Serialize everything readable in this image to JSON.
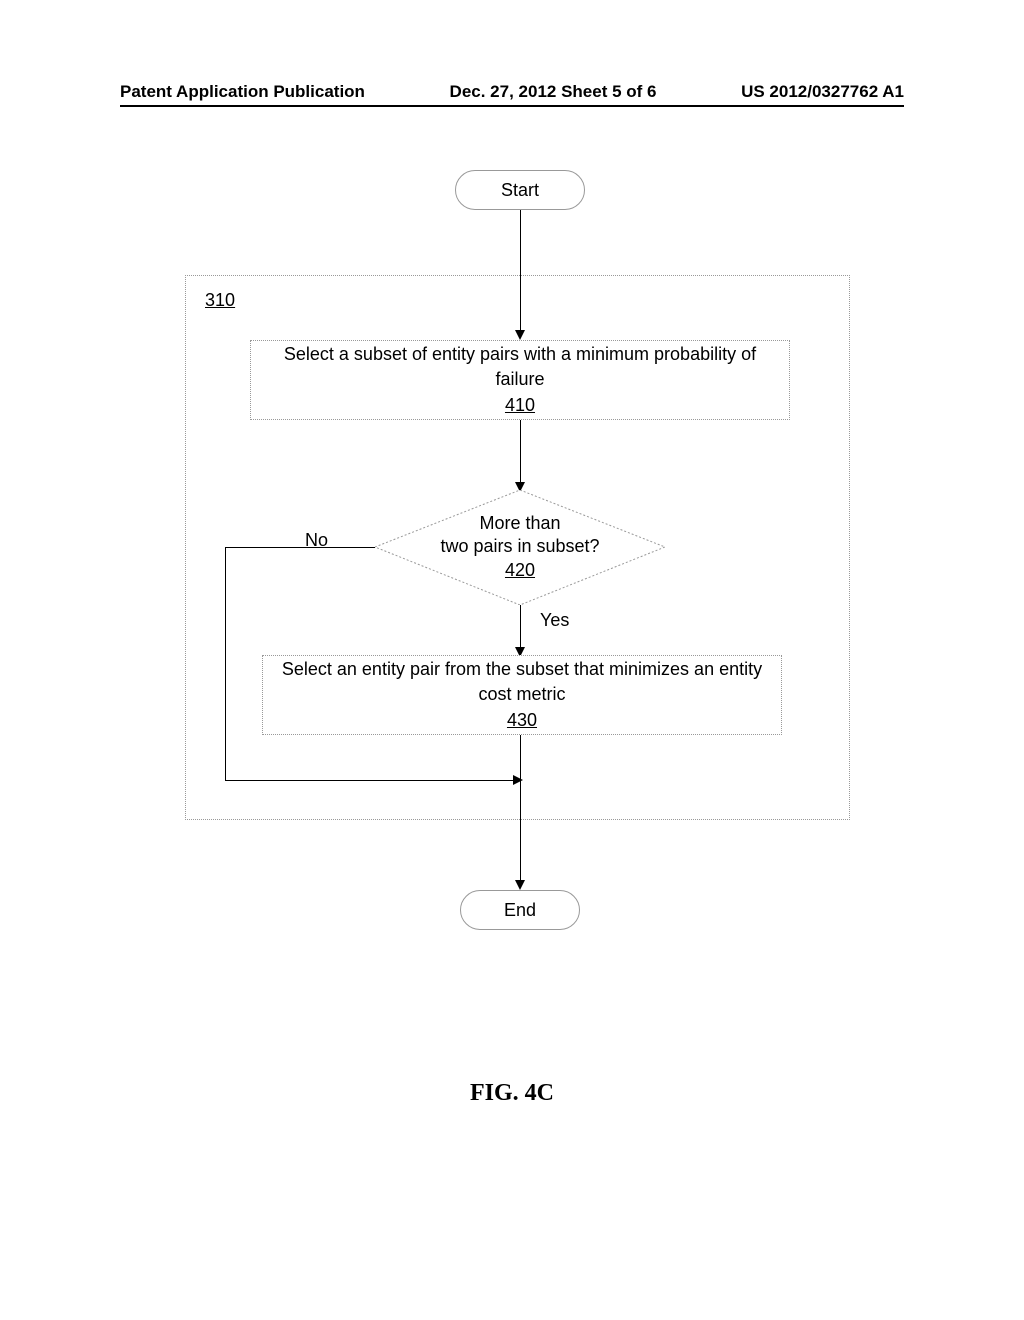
{
  "header": {
    "left": "Patent Application Publication",
    "center": "Dec. 27, 2012  Sheet 5 of 6",
    "right": "US 2012/0327762 A1"
  },
  "flowchart": {
    "start_label": "Start",
    "end_label": "End",
    "container_ref": "310",
    "step_410": {
      "text": "Select a subset of entity pairs with a minimum probability of failure",
      "ref": "410"
    },
    "decision_420": {
      "text_line1": "More than",
      "text_line2": "two pairs in subset?",
      "ref": "420",
      "no_label": "No",
      "yes_label": "Yes"
    },
    "step_430": {
      "text": "Select an entity pair from the subset that minimizes an entity cost metric",
      "ref": "430"
    }
  },
  "figure_label": "FIG. 4C"
}
